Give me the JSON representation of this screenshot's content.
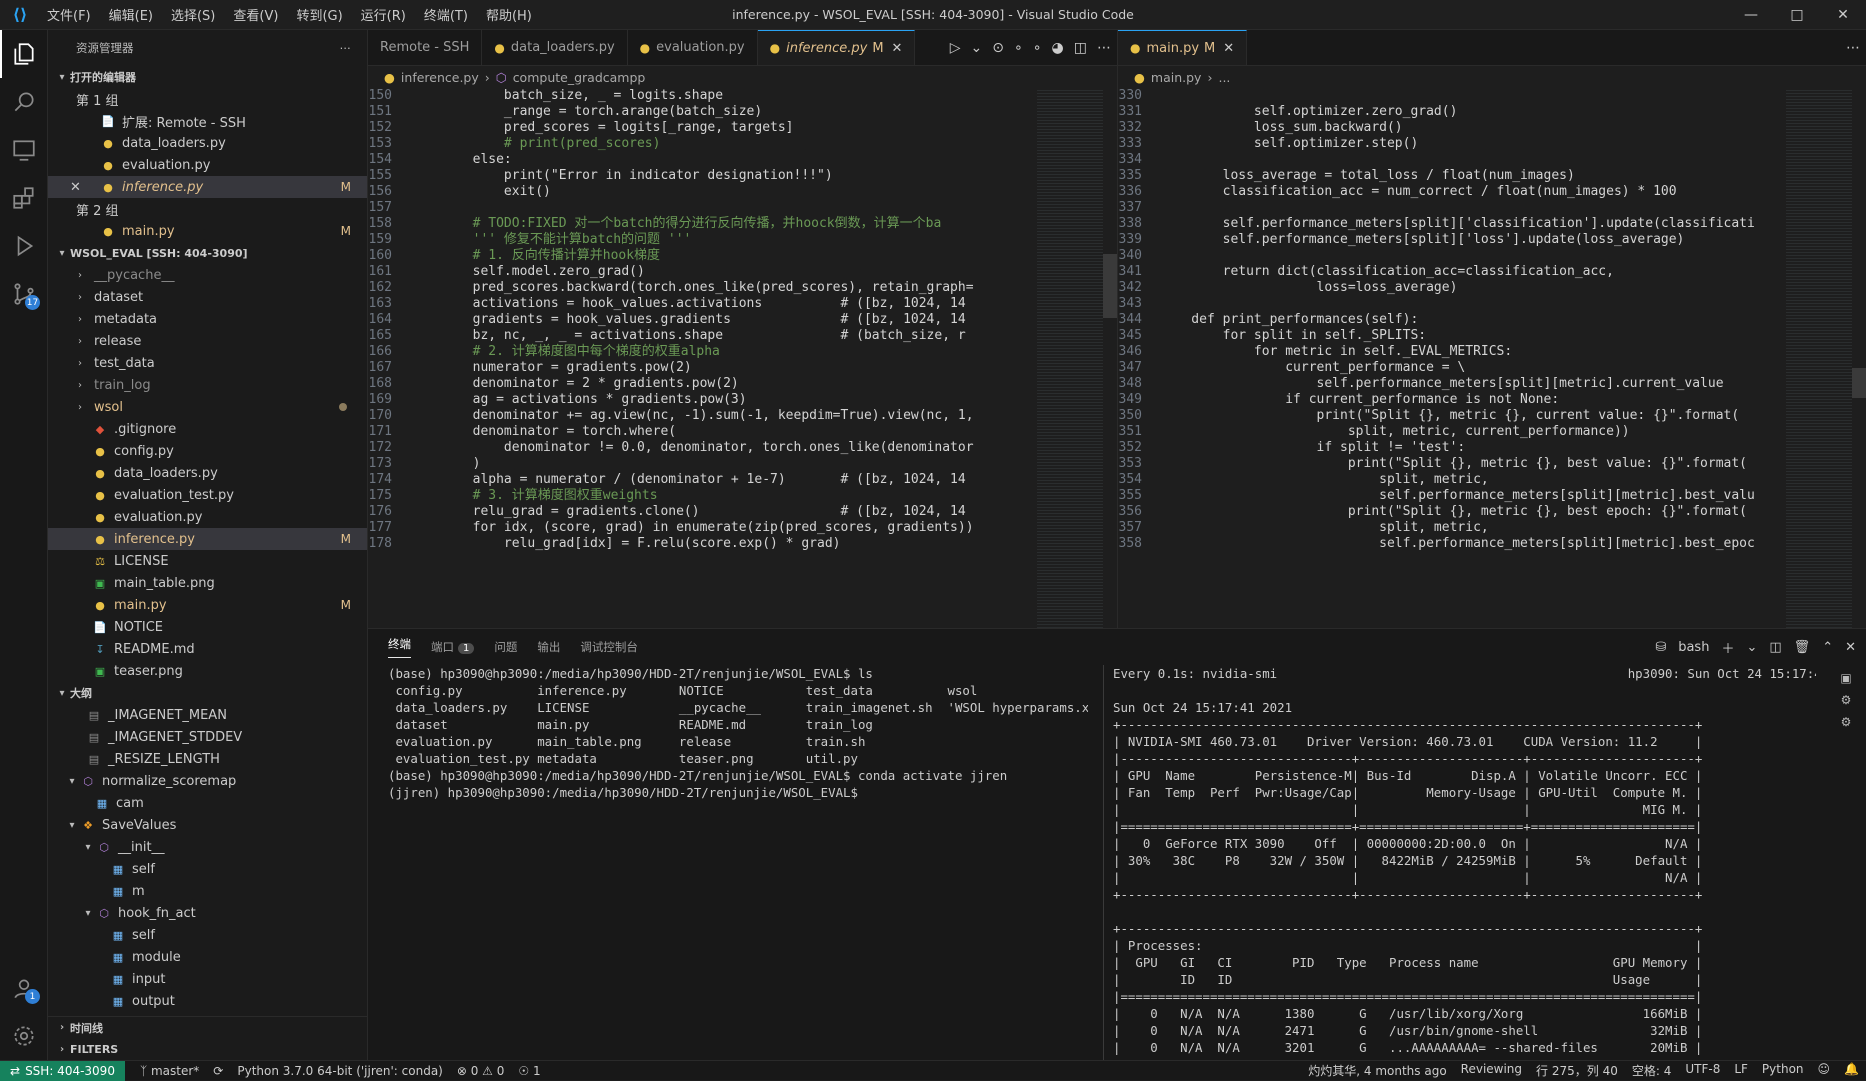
{
  "titlebar": {
    "menus": [
      "文件(F)",
      "编辑(E)",
      "选择(S)",
      "查看(V)",
      "转到(G)",
      "运行(R)",
      "终端(T)",
      "帮助(H)"
    ],
    "title": "inference.py - WSOL_EVAL [SSH: 404-3090] - Visual Studio Code"
  },
  "activity": {
    "remote_badge": "17",
    "accounts_badge": "1"
  },
  "sidebar": {
    "header": "资源管理器",
    "open_editors": "打开的编辑器",
    "group1": "第 1 组",
    "group2": "第 2 组",
    "open_items": [
      {
        "name": "扩展: Remote - SSH",
        "mark": ""
      },
      {
        "name": "data_loaders.py",
        "mark": ""
      },
      {
        "name": "evaluation.py",
        "mark": ""
      },
      {
        "name": "inference.py",
        "mark": "M"
      }
    ],
    "group2_items": [
      {
        "name": "main.py",
        "mark": "M"
      }
    ],
    "workspace": "WSOL_EVAL [SSH: 404-3090]",
    "folders": [
      "__pycache__",
      "dataset",
      "metadata",
      "release",
      "test_data",
      "train_log",
      "wsol"
    ],
    "files": [
      {
        "name": ".gitignore",
        "mark": ""
      },
      {
        "name": "config.py",
        "mark": ""
      },
      {
        "name": "data_loaders.py",
        "mark": ""
      },
      {
        "name": "evaluation_test.py",
        "mark": ""
      },
      {
        "name": "evaluation.py",
        "mark": ""
      },
      {
        "name": "inference.py",
        "mark": "M"
      },
      {
        "name": "LICENSE",
        "mark": ""
      },
      {
        "name": "main_table.png",
        "mark": ""
      },
      {
        "name": "main.py",
        "mark": "M"
      },
      {
        "name": "NOTICE",
        "mark": ""
      },
      {
        "name": "README.md",
        "mark": ""
      },
      {
        "name": "teaser.png",
        "mark": ""
      }
    ],
    "outline": "大纲",
    "outline_items": [
      {
        "name": "_IMAGENET_MEAN",
        "kind": "const"
      },
      {
        "name": "_IMAGENET_STDDEV",
        "kind": "const"
      },
      {
        "name": "_RESIZE_LENGTH",
        "kind": "const"
      },
      {
        "name": "normalize_scoremap",
        "kind": "func"
      },
      {
        "name": "cam",
        "kind": "var"
      },
      {
        "name": "SaveValues",
        "kind": "class"
      },
      {
        "name": "__init__",
        "kind": "func"
      },
      {
        "name": "self",
        "kind": "var"
      },
      {
        "name": "m",
        "kind": "var"
      },
      {
        "name": "hook_fn_act",
        "kind": "func"
      },
      {
        "name": "self",
        "kind": "var"
      },
      {
        "name": "module",
        "kind": "var"
      },
      {
        "name": "input",
        "kind": "var"
      },
      {
        "name": "output",
        "kind": "var"
      }
    ],
    "timeline": "时间线",
    "filters": "FILTERS"
  },
  "editor1": {
    "tabs": [
      {
        "label": "Remote - SSH",
        "mark": ""
      },
      {
        "label": "data_loaders.py",
        "mark": ""
      },
      {
        "label": "evaluation.py",
        "mark": ""
      },
      {
        "label": "inference.py",
        "mark": "M"
      }
    ],
    "crumb_file": "inference.py",
    "crumb_symbol": "compute_gradcampp",
    "lines": [
      {
        "n": "150",
        "t": "            batch_size, _ = logits.shape"
      },
      {
        "n": "151",
        "t": "            _range = torch.arange(batch_size)"
      },
      {
        "n": "152",
        "t": "            pred_scores = logits[_range, targets]"
      },
      {
        "n": "153",
        "t": "            # print(pred_scores)"
      },
      {
        "n": "154",
        "t": "        else:"
      },
      {
        "n": "155",
        "t": "            print(\"Error in indicator designation!!!\")"
      },
      {
        "n": "156",
        "t": "            exit()"
      },
      {
        "n": "157",
        "t": ""
      },
      {
        "n": "158",
        "t": "        # TODO:FIXED 对一个batch的得分进行反向传播，并hoock倒数，计算一个ba"
      },
      {
        "n": "159",
        "t": "        ''' 修复不能计算batch的问题 '''"
      },
      {
        "n": "160",
        "t": "        # 1. 反向传播计算并hook梯度"
      },
      {
        "n": "161",
        "t": "        self.model.zero_grad()"
      },
      {
        "n": "162",
        "t": "        pred_scores.backward(torch.ones_like(pred_scores), retain_graph="
      },
      {
        "n": "163",
        "t": "        activations = hook_values.activations          # ([bz, 1024, 14"
      },
      {
        "n": "164",
        "t": "        gradients = hook_values.gradients              # ([bz, 1024, 14"
      },
      {
        "n": "165",
        "t": "        bz, nc, _, _ = activations.shape               # (batch_size, r"
      },
      {
        "n": "166",
        "t": "        # 2. 计算梯度图中每个梯度的权重alpha"
      },
      {
        "n": "167",
        "t": "        numerator = gradients.pow(2)"
      },
      {
        "n": "168",
        "t": "        denominator = 2 * gradients.pow(2)"
      },
      {
        "n": "169",
        "t": "        ag = activations * gradients.pow(3)"
      },
      {
        "n": "170",
        "t": "        denominator += ag.view(nc, -1).sum(-1, keepdim=True).view(nc, 1,"
      },
      {
        "n": "171",
        "t": "        denominator = torch.where("
      },
      {
        "n": "172",
        "t": "            denominator != 0.0, denominator, torch.ones_like(denominator"
      },
      {
        "n": "173",
        "t": "        )"
      },
      {
        "n": "174",
        "t": "        alpha = numerator / (denominator + 1e-7)       # ([bz, 1024, 14"
      },
      {
        "n": "175",
        "t": "        # 3. 计算梯度图权重weights"
      },
      {
        "n": "176",
        "t": "        relu_grad = gradients.clone()                  # ([bz, 1024, 14"
      },
      {
        "n": "177",
        "t": "        for idx, (score, grad) in enumerate(zip(pred_scores, gradients))"
      },
      {
        "n": "178",
        "t": "            relu_grad[idx] = F.relu(score.exp() * grad)"
      }
    ]
  },
  "editor2": {
    "tabs": [
      {
        "label": "main.py",
        "mark": "M"
      }
    ],
    "crumb_file": "main.py",
    "crumb_symbol": "...",
    "lines": [
      {
        "n": "330",
        "t": ""
      },
      {
        "n": "331",
        "t": "            self.optimizer.zero_grad()"
      },
      {
        "n": "332",
        "t": "            loss_sum.backward()"
      },
      {
        "n": "333",
        "t": "            self.optimizer.step()"
      },
      {
        "n": "334",
        "t": ""
      },
      {
        "n": "335",
        "t": "        loss_average = total_loss / float(num_images)"
      },
      {
        "n": "336",
        "t": "        classification_acc = num_correct / float(num_images) * 100"
      },
      {
        "n": "337",
        "t": ""
      },
      {
        "n": "338",
        "t": "        self.performance_meters[split]['classification'].update(classificati"
      },
      {
        "n": "339",
        "t": "        self.performance_meters[split]['loss'].update(loss_average)"
      },
      {
        "n": "340",
        "t": ""
      },
      {
        "n": "341",
        "t": "        return dict(classification_acc=classification_acc,"
      },
      {
        "n": "342",
        "t": "                    loss=loss_average)"
      },
      {
        "n": "343",
        "t": ""
      },
      {
        "n": "344",
        "t": "    def print_performances(self):"
      },
      {
        "n": "345",
        "t": "        for split in self._SPLITS:"
      },
      {
        "n": "346",
        "t": "            for metric in self._EVAL_METRICS:"
      },
      {
        "n": "347",
        "t": "                current_performance = \\"
      },
      {
        "n": "348",
        "t": "                    self.performance_meters[split][metric].current_value"
      },
      {
        "n": "349",
        "t": "                if current_performance is not None:"
      },
      {
        "n": "350",
        "t": "                    print(\"Split {}, metric {}, current value: {}\".format("
      },
      {
        "n": "351",
        "t": "                        split, metric, current_performance))"
      },
      {
        "n": "352",
        "t": "                    if split != 'test':"
      },
      {
        "n": "353",
        "t": "                        print(\"Split {}, metric {}, best value: {}\".format("
      },
      {
        "n": "354",
        "t": "                            split, metric,"
      },
      {
        "n": "355",
        "t": "                            self.performance_meters[split][metric].best_valu"
      },
      {
        "n": "356",
        "t": "                        print(\"Split {}, metric {}, best epoch: {}\".format("
      },
      {
        "n": "357",
        "t": "                            split, metric,"
      },
      {
        "n": "358",
        "t": "                            self.performance_meters[split][metric].best_epoc"
      }
    ]
  },
  "panel": {
    "tabs": [
      "终端",
      "端口",
      "问题",
      "输出",
      "调试控制台"
    ],
    "port_count": "1",
    "shell": "bash",
    "term_left": [
      "(base) hp3090@hp3090:/media/hp3090/HDD-2T/renjunjie/WSOL_EVAL$ ls",
      " config.py          inference.py       NOTICE           test_data          wsol",
      " data_loaders.py    LICENSE            __pycache__      train_imagenet.sh  'WSOL hyperparams.xlsx'",
      " dataset            main.py            README.md        train_log",
      " evaluation.py      main_table.png     release          train.sh",
      " evaluation_test.py metadata           teaser.png       util.py",
      "(base) hp3090@hp3090:/media/hp3090/HDD-2T/renjunjie/WSOL_EVAL$ conda activate jjren",
      "(jjren) hp3090@hp3090:/media/hp3090/HDD-2T/renjunjie/WSOL_EVAL$ "
    ],
    "term_right": [
      "Every 0.1s: nvidia-smi                                               hp3090: Sun Oct 24 15:17:41 2021",
      "",
      "Sun Oct 24 15:17:41 2021",
      "+-----------------------------------------------------------------------------+",
      "| NVIDIA-SMI 460.73.01    Driver Version: 460.73.01    CUDA Version: 11.2     |",
      "|-------------------------------+----------------------+----------------------+",
      "| GPU  Name        Persistence-M| Bus-Id        Disp.A | Volatile Uncorr. ECC |",
      "| Fan  Temp  Perf  Pwr:Usage/Cap|         Memory-Usage | GPU-Util  Compute M. |",
      "|                               |                      |               MIG M. |",
      "|===============================+======================+======================|",
      "|   0  GeForce RTX 3090    Off  | 00000000:2D:00.0  On |                  N/A |",
      "| 30%   38C    P8    32W / 350W |   8422MiB / 24259MiB |      5%      Default |",
      "|                               |                      |                  N/A |",
      "+-------------------------------+----------------------+----------------------+",
      "",
      "+-----------------------------------------------------------------------------+",
      "| Processes:                                                                  |",
      "|  GPU   GI   CI        PID   Type   Process name                  GPU Memory |",
      "|        ID   ID                                                   Usage      |",
      "|=============================================================================|",
      "|    0   N/A  N/A      1380      G   /usr/lib/xorg/Xorg                166MiB |",
      "|    0   N/A  N/A      2471      G   /usr/bin/gnome-shell               32MiB |",
      "|    0   N/A  N/A      3201      G   ...AAAAAAAAA= --shared-files       20MiB |"
    ]
  },
  "status": {
    "remote": "SSH: 404-3090",
    "branch": "master*",
    "python": "Python 3.7.0 64-bit ('jjren': conda)",
    "problems": "0 ⚠ 0",
    "ports": "1",
    "blame": "灼灼其华, 4 months ago",
    "reviewing": "Reviewing",
    "position": "行 275，列 40",
    "spaces": "空格: 4",
    "encoding": "UTF-8",
    "eol": "LF",
    "language": "Python"
  }
}
